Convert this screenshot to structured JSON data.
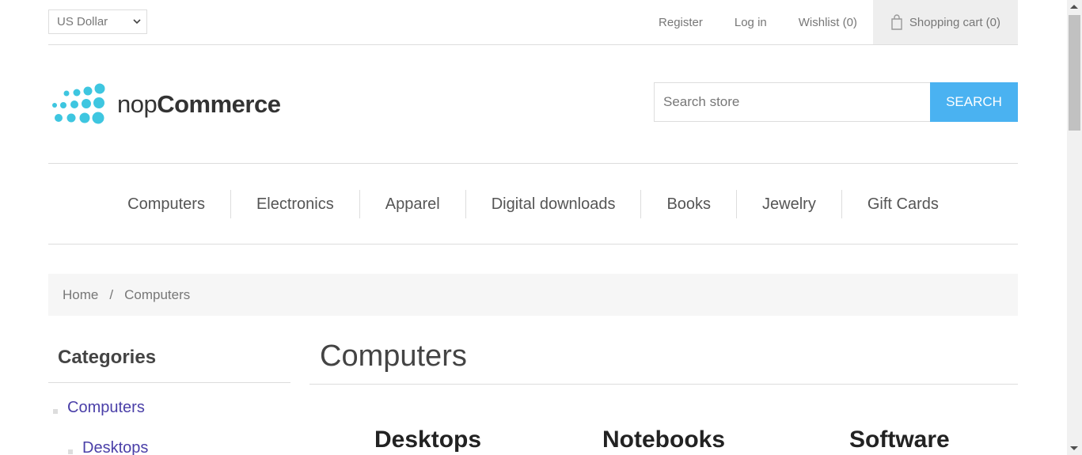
{
  "header": {
    "currency": "US Dollar",
    "links": {
      "register": "Register",
      "login": "Log in",
      "wishlist": "Wishlist (0)",
      "cart": "Shopping cart (0)"
    }
  },
  "logo": {
    "prefix": "nop",
    "brand": "Commerce"
  },
  "search": {
    "placeholder": "Search store",
    "button": "SEARCH"
  },
  "menu": [
    "Computers",
    "Electronics",
    "Apparel",
    "Digital downloads",
    "Books",
    "Jewelry",
    "Gift Cards"
  ],
  "breadcrumb": {
    "home": "Home",
    "separator": "/",
    "current": "Computers"
  },
  "sidebar": {
    "title": "Categories",
    "items": [
      "Computers",
      "Desktops"
    ]
  },
  "main": {
    "title": "Computers",
    "subcategories": [
      "Desktops",
      "Notebooks",
      "Software"
    ]
  },
  "colors": {
    "accent": "#4ab2f1",
    "logo_dots": "#3ec6e0",
    "link": "#4a3fa8"
  }
}
